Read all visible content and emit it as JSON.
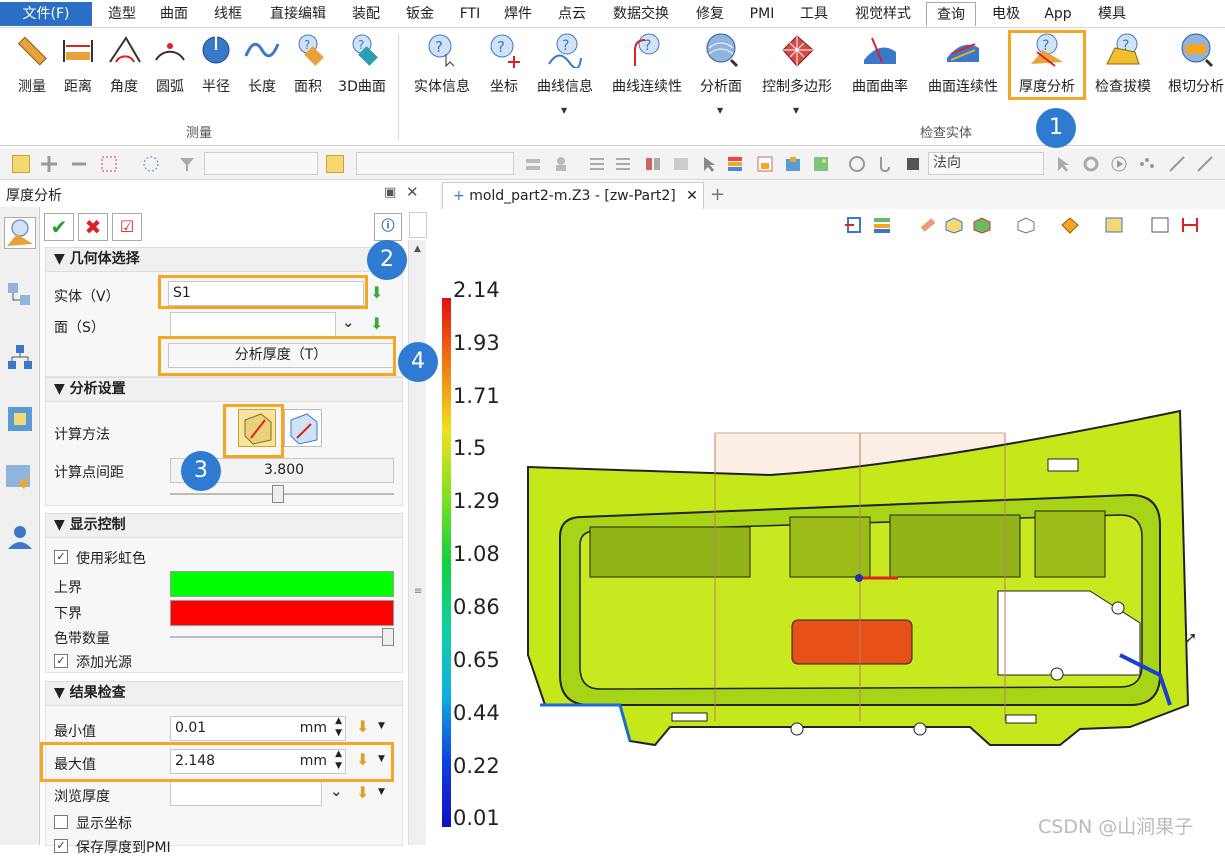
{
  "menubar": {
    "items": [
      "文件(F)",
      "造型",
      "曲面",
      "线框",
      "直接编辑",
      "装配",
      "钣金",
      "FTI",
      "焊件",
      "点云",
      "数据交换",
      "修复",
      "PMI",
      "工具",
      "视觉样式",
      "查询",
      "电极",
      "App",
      "模具"
    ],
    "active": "查询"
  },
  "ribbon": {
    "measure_group": "测量",
    "inspect_group": "检查实体",
    "buttons": [
      "测量",
      "距离",
      "角度",
      "圆弧",
      "半径",
      "长度",
      "面积",
      "3D曲面",
      "实体信息",
      "坐标",
      "曲线信息",
      "曲线连续性",
      "分析面",
      "控制多边形",
      "曲面曲率",
      "曲面连续性",
      "厚度分析",
      "检查拔模",
      "根切分析"
    ]
  },
  "toolbar": {
    "direction_combo": "法向"
  },
  "panel": {
    "title": "厚度分析",
    "geometry_section": "几何体选择",
    "solid_label": "实体（V）",
    "solid_value": "S1",
    "face_label": "面（S）",
    "face_value": "",
    "analyze_button": "分析厚度（T）",
    "analysis_section": "分析设置",
    "calc_method_label": "计算方法",
    "point_spacing_label": "计算点间距",
    "point_spacing_value": "3.800",
    "point_spacing_level": 0.48,
    "display_section": "显示控制",
    "rainbow_label": "使用彩虹色",
    "upper_label": "上界",
    "lower_label": "下界",
    "band_count_label": "色带数量",
    "band_count_level": 1.0,
    "add_light_label": "添加光源",
    "result_section": "结果检查",
    "min_label": "最小值",
    "min_value": "0.01",
    "max_label": "最大值",
    "max_value": "2.148",
    "unit": "mm",
    "browse_label": "浏览厚度",
    "show_coords_label": "显示坐标",
    "save_label": "保存厚度到PMI"
  },
  "colors": {
    "upper": "#00ff00",
    "lower": "#ff0000",
    "highlight": "#f5a623",
    "badge": "#2e7bd1"
  },
  "badges": [
    "1",
    "2",
    "3",
    "4"
  ],
  "document_tab": "mold_part2-m.Z3 - [zw-Part2]",
  "legend": {
    "ticks": [
      "2.14",
      "1.93",
      "1.71",
      "1.5",
      "1.29",
      "1.08",
      "0.86",
      "0.65",
      "0.44",
      "0.22",
      "0.01"
    ]
  },
  "watermark": "CSDN @山涧果子"
}
